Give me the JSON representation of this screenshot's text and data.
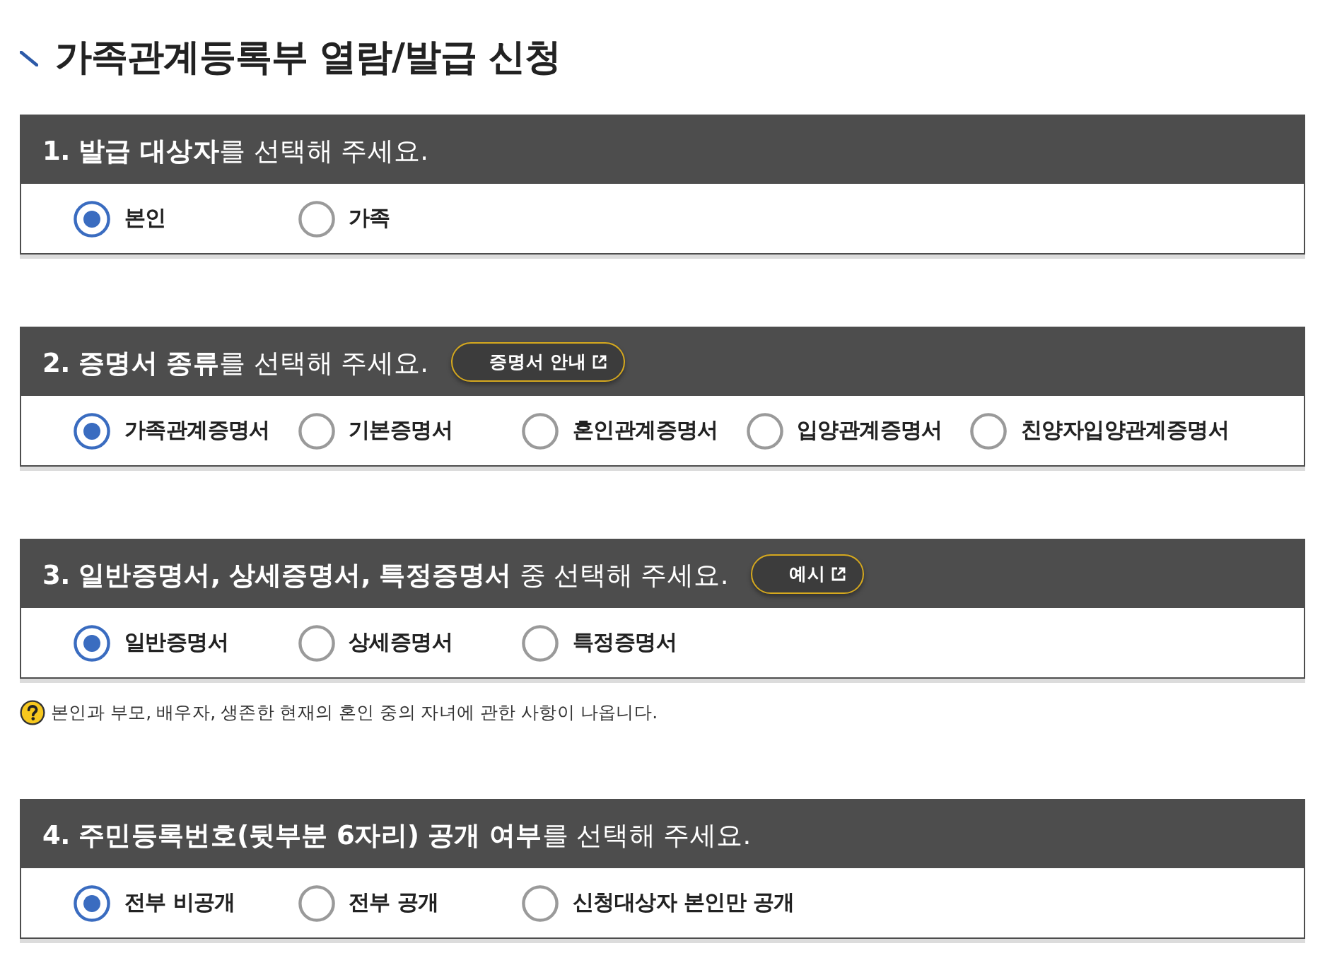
{
  "page_title": "가족관계등록부 열람/발급 신청",
  "sections": [
    {
      "heading": "**1. 발급 대상자**를 선택해 주세요.",
      "options": [
        {
          "label": "본인",
          "selected": true
        },
        {
          "label": "가족",
          "selected": false
        }
      ]
    },
    {
      "heading": "**2. 증명서 종류**를 선택해 주세요.",
      "button": {
        "label": "증명서 안내"
      },
      "options": [
        {
          "label": "가족관계증명서",
          "selected": true
        },
        {
          "label": "기본증명서",
          "selected": false
        },
        {
          "label": "혼인관계증명서",
          "selected": false
        },
        {
          "label": "입양관계증명서",
          "selected": false
        },
        {
          "label": "친양자입양관계증명서",
          "selected": false
        }
      ]
    },
    {
      "heading": "**3. 일반증명서, 상세증명서, 특정증명서** 중 선택해 주세요.",
      "button": {
        "label": "예시"
      },
      "options": [
        {
          "label": "일반증명서",
          "selected": true
        },
        {
          "label": "상세증명서",
          "selected": false
        },
        {
          "label": "특정증명서",
          "selected": false
        }
      ],
      "note": "본인과 부모, 배우자, 생존한 현재의 혼인 중의 자녀에 관한 사항이 나옵니다."
    },
    {
      "heading": "**4. 주민등록번호(뒷부분 6자리) 공개 여부**를 선택해 주세요.",
      "options": [
        {
          "label": "전부 비공개",
          "selected": true
        },
        {
          "label": "전부 공개",
          "selected": false
        },
        {
          "label": "신청대상자 본인만 공개",
          "selected": false
        }
      ]
    }
  ]
}
